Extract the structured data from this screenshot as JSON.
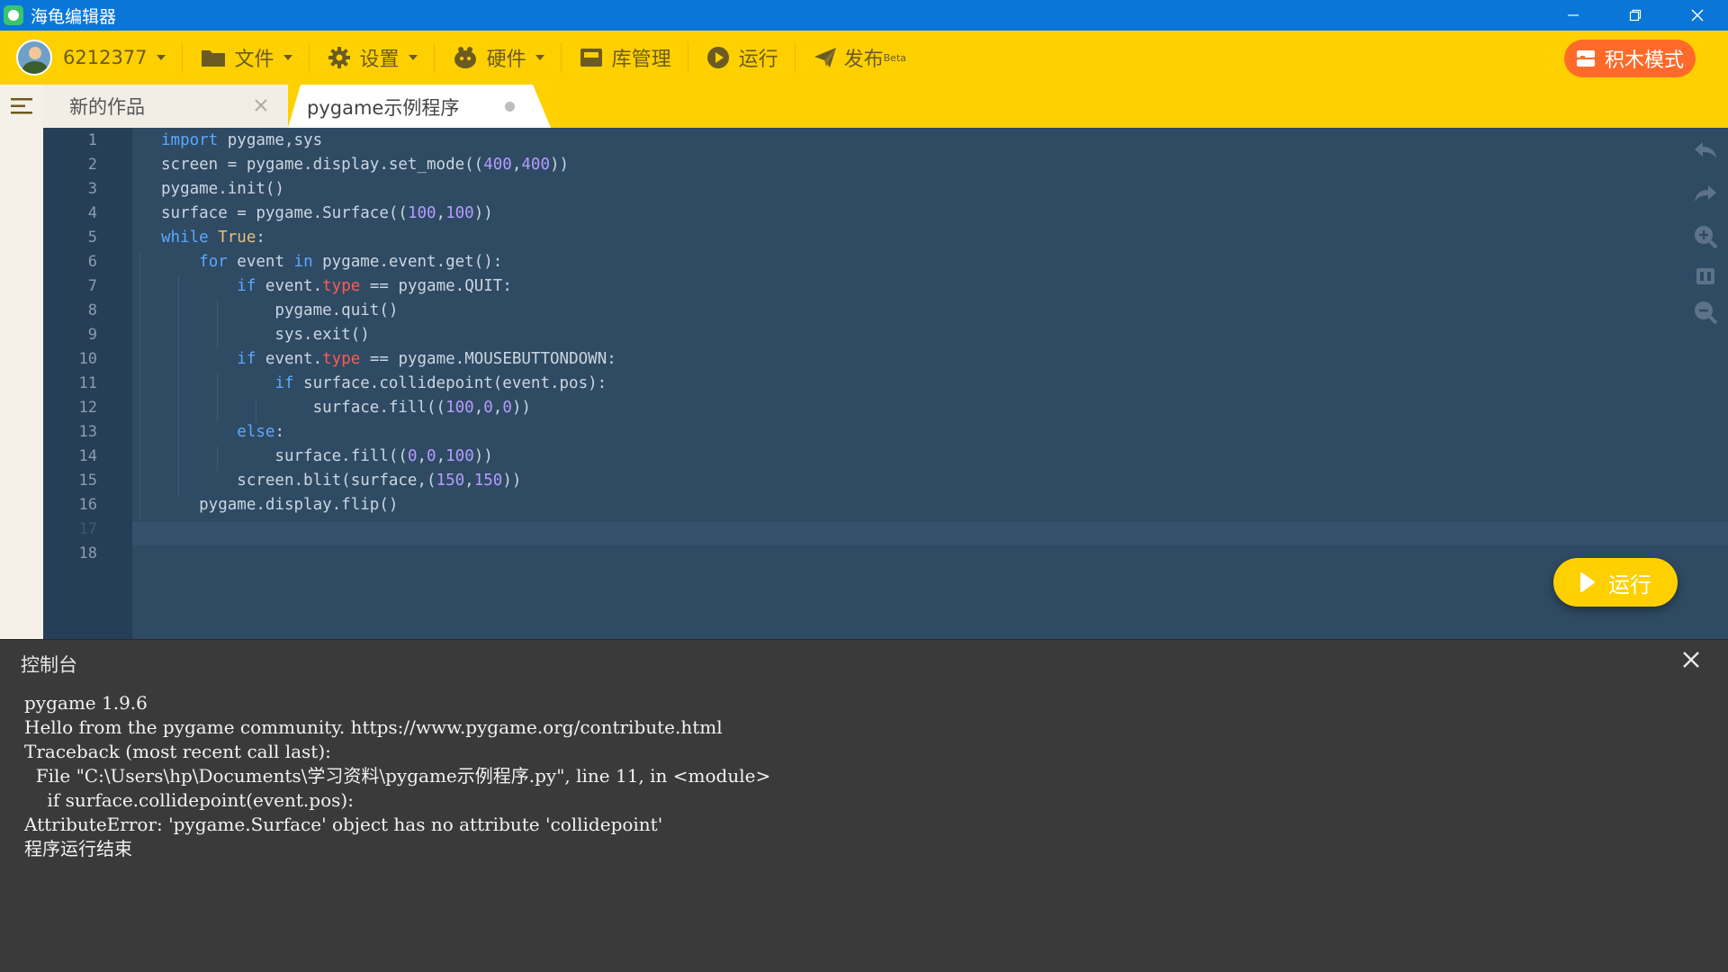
{
  "window": {
    "title": "海龟编辑器",
    "controls": [
      "minimize-icon",
      "restore-icon",
      "close-icon"
    ]
  },
  "toolbar": {
    "user_id": "6212377",
    "file_label": "文件",
    "settings_label": "设置",
    "hardware_label": "硬件",
    "library_label": "库管理",
    "run_label": "运行",
    "publish_label": "发布",
    "publish_badge": "Beta",
    "block_mode_label": "积木模式"
  },
  "tabs": [
    {
      "label": "新的作品",
      "state": "closable"
    },
    {
      "label": "pygame示例程序",
      "state": "active-unsaved"
    }
  ],
  "editor": {
    "line_numbers": [
      "1",
      "2",
      "3",
      "4",
      "5",
      "6",
      "7",
      "8",
      "9",
      "10",
      "11",
      "12",
      "13",
      "14",
      "15",
      "16",
      "17",
      "18"
    ],
    "active_line": 17,
    "run_button_label": "运行",
    "side_tools": [
      "undo-icon",
      "redo-icon",
      "zoom-in-icon",
      "fit-icon",
      "zoom-out-icon"
    ],
    "code": [
      "import pygame,sys",
      "screen = pygame.display.set_mode((400,400))",
      "pygame.init()",
      "surface = pygame.Surface((100,100))",
      "while True:",
      "    for event in pygame.event.get():",
      "        if event.type == pygame.QUIT:",
      "            pygame.quit()",
      "            sys.exit()",
      "        if event.type == pygame.MOUSEBUTTONDOWN:",
      "            if surface.collidepoint(event.pos):",
      "                surface.fill((100,0,0))",
      "        else:",
      "            surface.fill((0,0,100))",
      "        screen.blit(surface,(150,150))",
      "    pygame.display.flip()",
      "",
      ""
    ]
  },
  "console": {
    "title": "控制台",
    "lines": [
      "pygame 1.9.6",
      "Hello from the pygame community. https://www.pygame.org/contribute.html",
      "Traceback (most recent call last):",
      "  File \"C:\\Users\\hp\\Documents\\学习资料\\pygame示例程序.py\", line 11, in <module>",
      "    if surface.collidepoint(event.pos):",
      "AttributeError: 'pygame.Surface' object has no attribute 'collidepoint'",
      "程序运行结束"
    ]
  },
  "colors": {
    "titlebar": "#0a77d8",
    "toolbar": "#ffd000",
    "editor_bg": "#2f4a63",
    "console_bg": "#3a3a3a",
    "block_mode_button": "#ff6a2a",
    "keyword": "#5ba8ff",
    "number": "#b49cff",
    "attribute": "#ff5a52"
  }
}
